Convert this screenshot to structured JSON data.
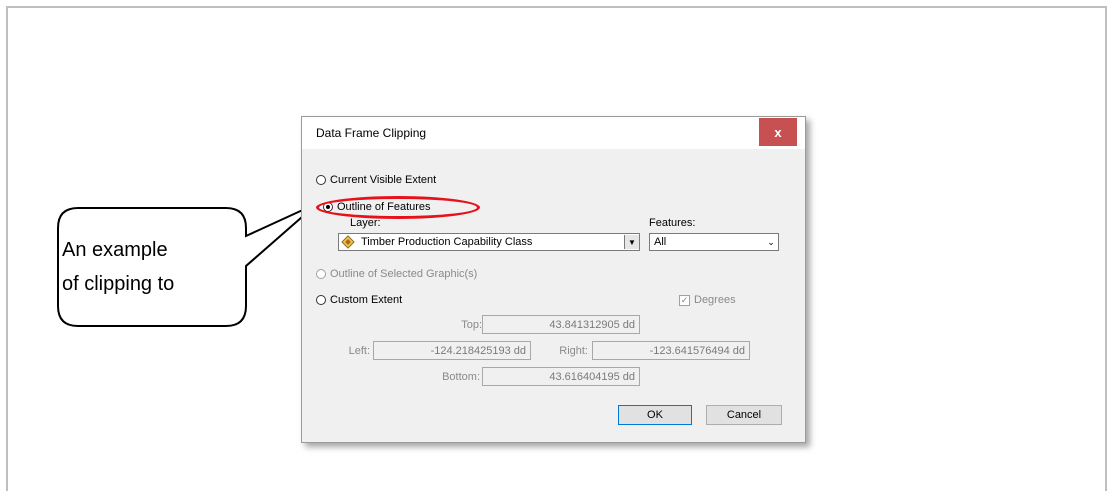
{
  "dialog": {
    "title": "Data Frame Clipping",
    "close_glyph": "x",
    "options": {
      "current_visible_extent": "Current Visible Extent",
      "outline_of_features": "Outline of Features",
      "outline_of_selected_graphics": "Outline of Selected Graphic(s)",
      "custom_extent": "Custom Extent"
    },
    "layer_label": "Layer:",
    "layer_value": "Timber Production Capability Class",
    "features_label": "Features:",
    "features_value": "All",
    "degrees_label": "Degrees",
    "degrees_checked": true,
    "extent": {
      "top_label": "Top:",
      "top_value": "43.841312905 dd",
      "left_label": "Left:",
      "left_value": "-124.218425193 dd",
      "right_label": "Right:",
      "right_value": "-123.641576494 dd",
      "bottom_label": "Bottom:",
      "bottom_value": "43.616404195 dd"
    },
    "ok_label": "OK",
    "cancel_label": "Cancel"
  },
  "callout": {
    "line1": "An example",
    "line2": "of clipping to"
  },
  "colors": {
    "highlight": "#e8101a",
    "close_button": "#c75050"
  }
}
